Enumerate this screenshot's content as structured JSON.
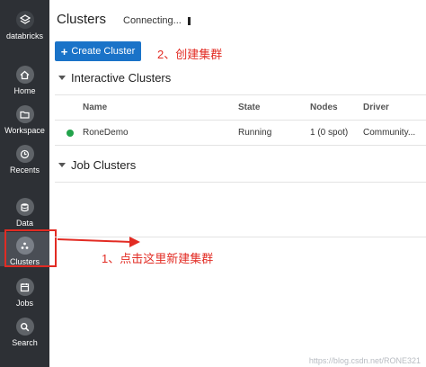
{
  "sidebar": {
    "brand": "databricks",
    "items": [
      {
        "label": "Home",
        "icon": "home-icon"
      },
      {
        "label": "Workspace",
        "icon": "folder-icon"
      },
      {
        "label": "Recents",
        "icon": "clock-icon"
      },
      {
        "label": "Data",
        "icon": "database-icon"
      },
      {
        "label": "Clusters",
        "icon": "clusters-icon"
      },
      {
        "label": "Jobs",
        "icon": "calendar-icon"
      },
      {
        "label": "Search",
        "icon": "search-icon"
      }
    ]
  },
  "main": {
    "title": "Clusters",
    "status": "Connecting...",
    "create_button": "Create Cluster",
    "interactive_section": "Interactive Clusters",
    "job_section": "Job Clusters",
    "columns": [
      "Name",
      "State",
      "Nodes",
      "Driver"
    ],
    "rows": [
      {
        "name": "RoneDemo",
        "state": "Running",
        "nodes": "1 (0 spot)",
        "driver": "Community..."
      }
    ]
  },
  "annotations": {
    "step2": "2、创建集群",
    "step1": "1、点击这里新建集群"
  },
  "watermark": "https://blog.csdn.net/RONE321",
  "colors": {
    "accent": "#1a73c8",
    "annotation": "#e22b23",
    "running": "#22a34b",
    "sidebar": "#2d3035"
  }
}
